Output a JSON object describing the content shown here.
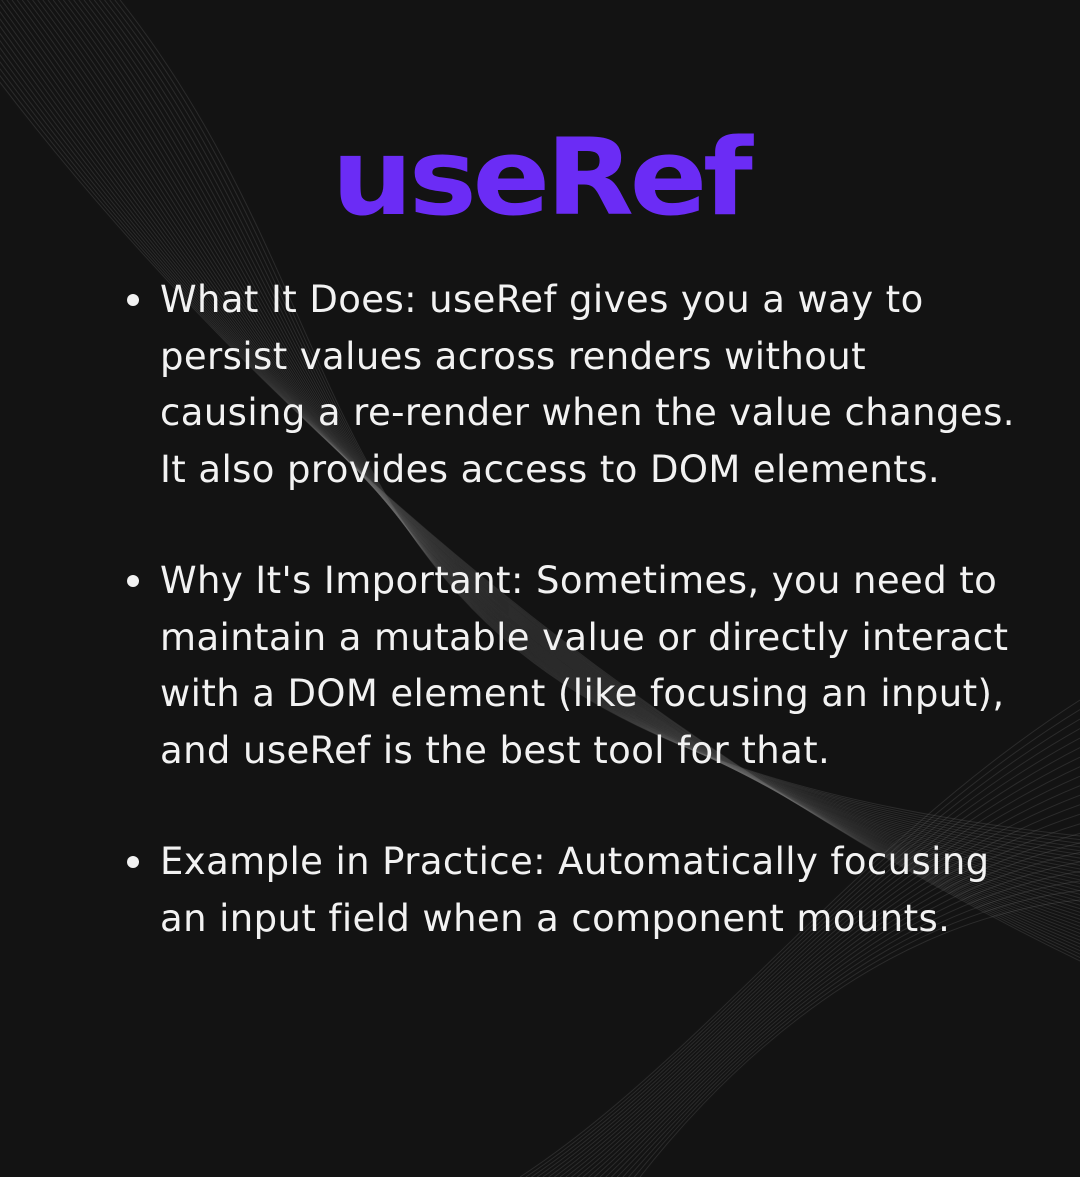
{
  "title": "useRef",
  "bullets": [
    {
      "text": "What It Does: useRef gives you a way to persist values across renders without causing a re-render when the value changes. It also provides access to DOM elements."
    },
    {
      "text": "Why It's Important: Sometimes, you need to maintain a mutable value or directly interact with a DOM element (like focusing an input), and useRef is the best tool for that."
    },
    {
      "text": "Example in Practice: Automatically focusing an input field when a component mounts."
    }
  ],
  "colors": {
    "background": "#131313",
    "title": "#6b2cf5",
    "text": "#f2f2f2"
  }
}
